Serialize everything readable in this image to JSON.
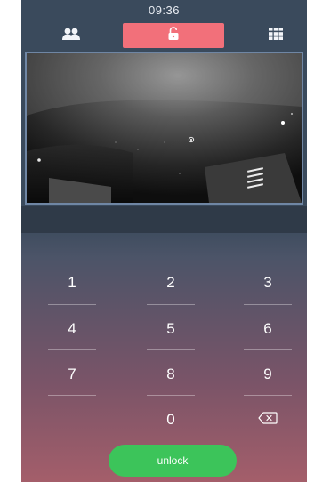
{
  "status_bar": {
    "time": "09:36"
  },
  "tabs": [
    {
      "name": "contacts",
      "icon": "contacts-icon"
    },
    {
      "name": "unlock",
      "icon": "unlock-icon",
      "active": true,
      "color": "#f2707a"
    },
    {
      "name": "grid",
      "icon": "grid-icon"
    }
  ],
  "keypad": {
    "keys": [
      "1",
      "2",
      "3",
      "4",
      "5",
      "6",
      "7",
      "8",
      "9",
      "0"
    ],
    "backspace_icon": "backspace-icon"
  },
  "unlock_button": {
    "label": "unlock",
    "color": "#3cc45a"
  }
}
